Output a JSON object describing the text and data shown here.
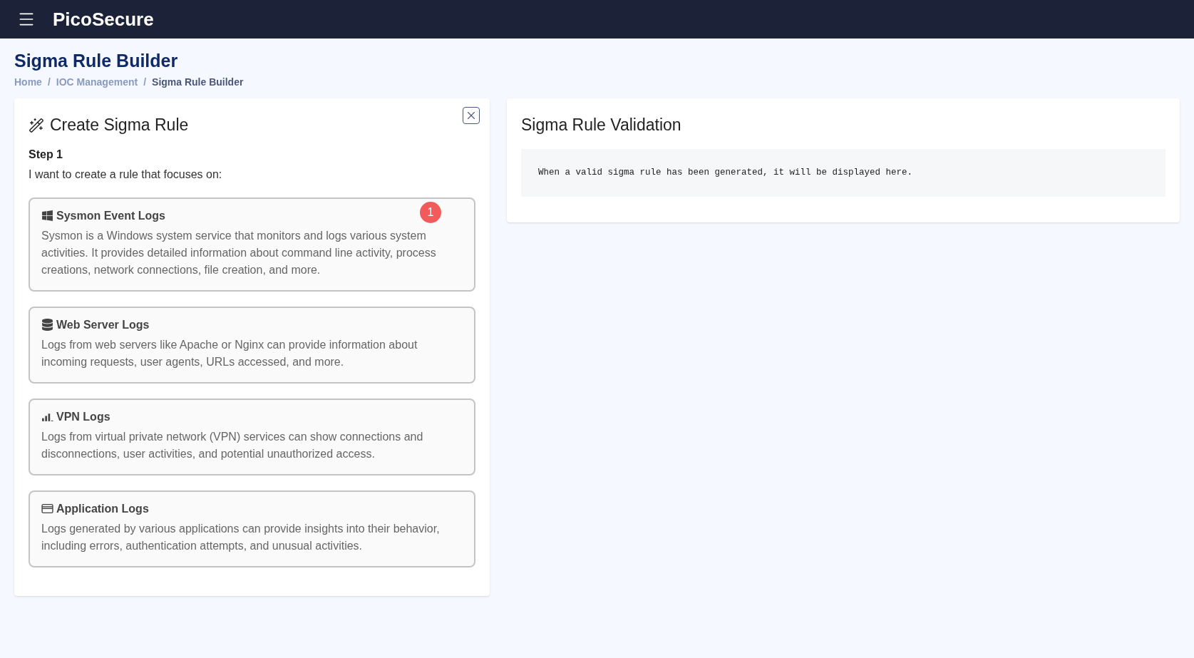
{
  "app": {
    "title": "PicoSecure"
  },
  "page": {
    "title": "Sigma Rule Builder",
    "breadcrumb_separator": "/",
    "breadcrumb": [
      {
        "label": "Home",
        "current": false
      },
      {
        "label": "IOC Management",
        "current": false
      },
      {
        "label": "Sigma Rule Builder",
        "current": true
      }
    ]
  },
  "create_panel": {
    "title": "Create Sigma Rule",
    "step": "Step 1",
    "prompt": "I want to create a rule that focuses on:",
    "options": [
      {
        "kind": "windows",
        "title": "Sysmon Event Logs",
        "description": "Sysmon is a Windows system service that monitors and logs various system activities. It provides detailed information about command line activity, process creations, network connections, file creation, and more.",
        "badge": "1"
      },
      {
        "kind": "database",
        "title": "Web Server Logs",
        "description": "Logs from web servers like Apache or Nginx can provide information about incoming requests, user agents, URLs accessed, and more."
      },
      {
        "kind": "signal",
        "title": "VPN Logs",
        "description": "Logs from virtual private network (VPN) services can show connections and disconnections, user activities, and potential unauthorized access."
      },
      {
        "kind": "window",
        "title": "Application Logs",
        "description": "Logs generated by various applications can provide insights into their behavior, including errors, authentication attempts, and unusual activities."
      }
    ]
  },
  "validation_panel": {
    "title": "Sigma Rule Validation",
    "output": "When a valid sigma rule has been generated, it will be displayed here."
  }
}
